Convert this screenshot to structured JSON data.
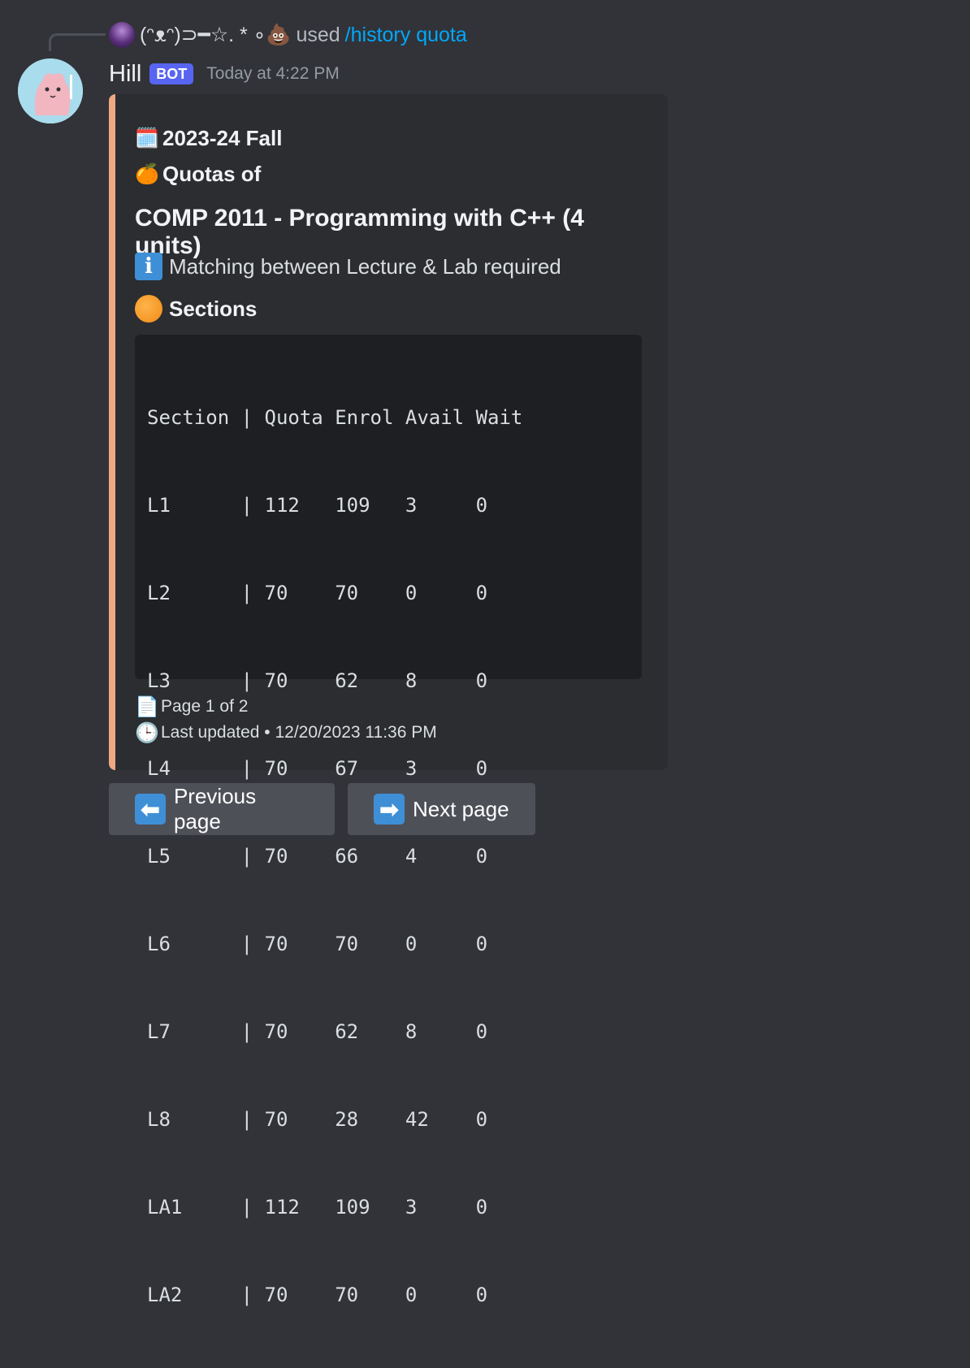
{
  "reply": {
    "user": "(ᵔᴥᵔ)⊃━☆. * ∘💩",
    "used_text": "used",
    "command": "/history quota"
  },
  "message": {
    "username": "Hill",
    "bot_tag": "BOT",
    "timestamp": "Today at 4:22 PM"
  },
  "embed": {
    "accent_color": "#f0a883",
    "term_icon": "calendar-icon",
    "term": "2023-24 Fall",
    "quotas_icon": "tangerine-icon",
    "quotas_label": "Quotas of",
    "course_title": "COMP 2011 - Programming with C++ (4 units)",
    "info_icon": "info-icon",
    "info_text": "Matching between Lecture & Lab required",
    "sections_icon": "orange-circle-icon",
    "sections_label": "Sections",
    "table_header": "Section | Quota Enrol Avail Wait",
    "table_rows": [
      "L1      | 112   109   3     0",
      "L2      | 70    70    0     0",
      "L3      | 70    62    8     0",
      "L4      | 70    67    3     0",
      "L5      | 70    66    4     0",
      "L6      | 70    70    0     0",
      "L7      | 70    62    8     0",
      "L8      | 70    28    42    0",
      "LA1     | 112   109   3     0",
      "LA2     | 70    70    0     0"
    ],
    "page_icon": "page-icon",
    "page_text": "Page 1 of 2",
    "clock_icon": "clock-icon",
    "updated_text": "Last updated • 12/20/2023 11:36 PM"
  },
  "buttons": {
    "prev_label": "Previous page",
    "next_label": "Next page"
  }
}
